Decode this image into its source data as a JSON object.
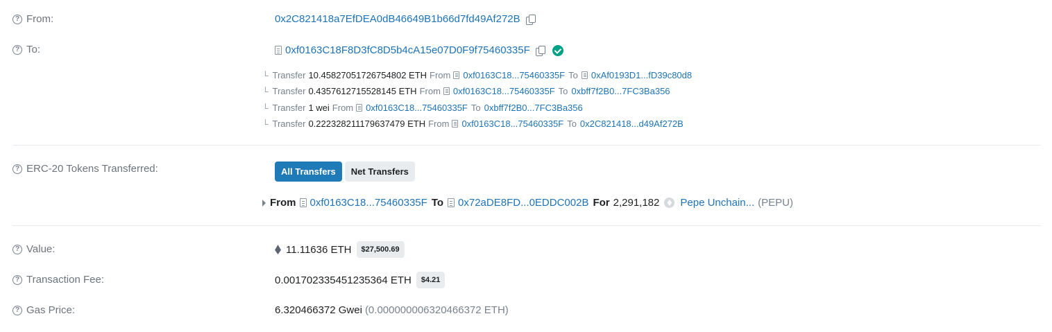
{
  "from": {
    "label": "From:",
    "address": "0x2C821418a7EfDEA0dB46649B1b66d7fd49Af272B"
  },
  "to": {
    "label": "To:",
    "address": "0xf0163C18F8D3fC8D5b4cA15e07D0F9f75460335F"
  },
  "internal_transfers": [
    {
      "prefix": "Transfer",
      "amount": "10.45827051726754802 ETH",
      "from_word": "From",
      "from": "0xf0163C18...75460335F",
      "to_word": "To",
      "to": "0xAf0193D1...fD39c80d8",
      "to_is_contract": true
    },
    {
      "prefix": "Transfer",
      "amount": "0.4357612715528145 ETH",
      "from_word": "From",
      "from": "0xf0163C18...75460335F",
      "to_word": "To",
      "to": "0xbff7f2B0...7FC3Ba356",
      "to_is_contract": false
    },
    {
      "prefix": "Transfer",
      "amount": "1 wei",
      "from_word": "From",
      "from": "0xf0163C18...75460335F",
      "to_word": "To",
      "to": "0xbff7f2B0...7FC3Ba356",
      "to_is_contract": false
    },
    {
      "prefix": "Transfer",
      "amount": "0.222328211179637479 ETH",
      "from_word": "From",
      "from": "0xf0163C18...75460335F",
      "to_word": "To",
      "to": "0x2C821418...d49Af272B",
      "to_is_contract": false
    }
  ],
  "erc20": {
    "label": "ERC-20 Tokens Transferred:",
    "tabs": [
      "All Transfers",
      "Net Transfers"
    ],
    "transfer": {
      "from_word": "From",
      "from": "0xf0163C18...75460335F",
      "to_word": "To",
      "to": "0x72aDE8FD...0EDDC002B",
      "for_word": "For",
      "amount": "2,291,182",
      "token_name": "Pepe Unchain...",
      "token_symbol": "(PEPU)"
    }
  },
  "value": {
    "label": "Value:",
    "amount": "11.11636 ETH",
    "usd": "$27,500.69"
  },
  "fee": {
    "label": "Transaction Fee:",
    "amount": "0.001702335451235364 ETH",
    "usd": "$4.21"
  },
  "gas": {
    "label": "Gas Price:",
    "amount": "6.320466372 Gwei",
    "eth": "(0.000000006320466372 ETH)"
  },
  "colors": {
    "link": "#1e73b8",
    "active_button": "#1f7ab8",
    "verified_check": "#00a186",
    "label_gray": "#6c757d"
  }
}
